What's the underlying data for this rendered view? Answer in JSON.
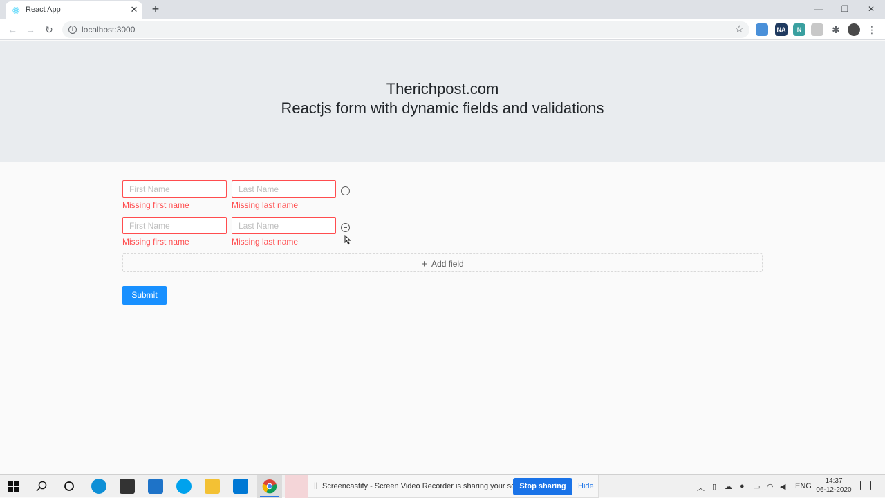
{
  "browser": {
    "tab_title": "React App",
    "tab_close": "✕",
    "new_tab": "+",
    "url": "localhost:3000",
    "window_controls": {
      "minimize": "—",
      "maximize": "❐",
      "close": "✕"
    },
    "nav": {
      "back": "←",
      "forward": "→",
      "reload": "↻"
    },
    "star": "☆",
    "menu": "⋮",
    "extensions": [
      {
        "icon": "download-ext-icon",
        "text": "",
        "color": "#4a90d9"
      },
      {
        "icon": "na-ext-icon",
        "text": "NA",
        "color": "#1f3a60"
      },
      {
        "icon": "n-ext-icon",
        "text": "N",
        "color": "#3aa0a0"
      },
      {
        "icon": "shield-ext-icon",
        "text": "",
        "color": "#c8c8c8"
      },
      {
        "icon": "puzzle-icon",
        "text": "✱",
        "color": "#5f6368"
      }
    ]
  },
  "hero": {
    "title": "Therichpost.com",
    "subtitle": "Reactjs form with dynamic fields and validations"
  },
  "form": {
    "rows": [
      {
        "first_placeholder": "First Name",
        "last_placeholder": "Last Name",
        "first_error": "Missing first name",
        "last_error": "Missing last name"
      },
      {
        "first_placeholder": "First Name",
        "last_placeholder": "Last Name",
        "first_error": "Missing first name",
        "last_error": "Missing last name"
      }
    ],
    "add_field_icon": "+",
    "add_field_label": "Add field",
    "submit_label": "Submit"
  },
  "colors": {
    "error": "#ff4d4f",
    "primary": "#1890ff",
    "hero_bg": "#e9ecef"
  },
  "taskbar": {
    "screencastify_text": "Screencastify - Screen Video Recorder is sharing your screen.",
    "grip": "||",
    "stop_label": "Stop sharing",
    "hide_label": "Hide",
    "language": "ENG",
    "time": "14:37",
    "date": "06-12-2020",
    "apps": [
      "windows-start-icon",
      "search-icon",
      "cortana-icon",
      "edge-icon",
      "store-icon",
      "mail-icon",
      "skype-icon",
      "file-explorer-icon",
      "vscode-icon",
      "chrome-icon"
    ]
  }
}
